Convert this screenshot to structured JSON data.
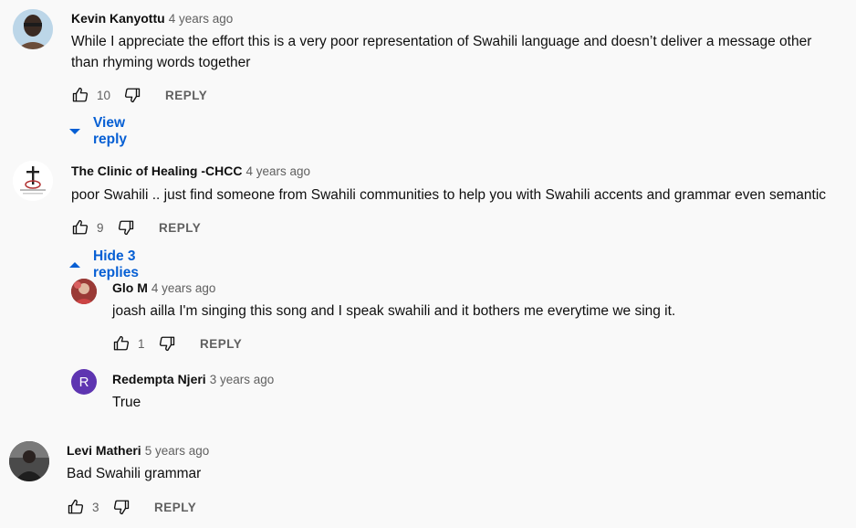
{
  "labels": {
    "reply": "REPLY"
  },
  "icons": {
    "like": "thumbs-up-icon",
    "dislike": "thumbs-down-icon"
  },
  "colors": {
    "link": "#065fd4",
    "meta": "#606060",
    "text": "#0f0f0f",
    "avatar_r": "#5e35b1"
  },
  "comments": [
    {
      "author": "Kevin Kanyottu",
      "time": "4 years ago",
      "text_lines": [
        "While I appreciate the effort this is a very poor representation of Swahili language and doesn’t deliver a message other",
        "than rhyming words together"
      ],
      "likes": "10",
      "replies_toggle": "View reply"
    },
    {
      "author": "The Clinic of Healing -CHCC",
      "time": "4 years ago",
      "text_lines": [
        "poor Swahili .. just find someone from Swahili communities to help you with Swahili accents and grammar even semantic"
      ],
      "likes": "9",
      "replies_toggle": "Hide 3 replies",
      "replies": [
        {
          "author": "Glo M",
          "time": "4 years ago",
          "text": "joash ailla I'm singing this song and I speak swahili and it bothers me everytime we sing it.",
          "likes": "1"
        },
        {
          "author": "Redempta Njeri",
          "time": "3 years ago",
          "text": "True",
          "avatar_letter": "R"
        }
      ]
    },
    {
      "author": "Levi Matheri",
      "time": "5 years ago",
      "text": "Bad Swahili grammar",
      "likes": "3"
    }
  ]
}
